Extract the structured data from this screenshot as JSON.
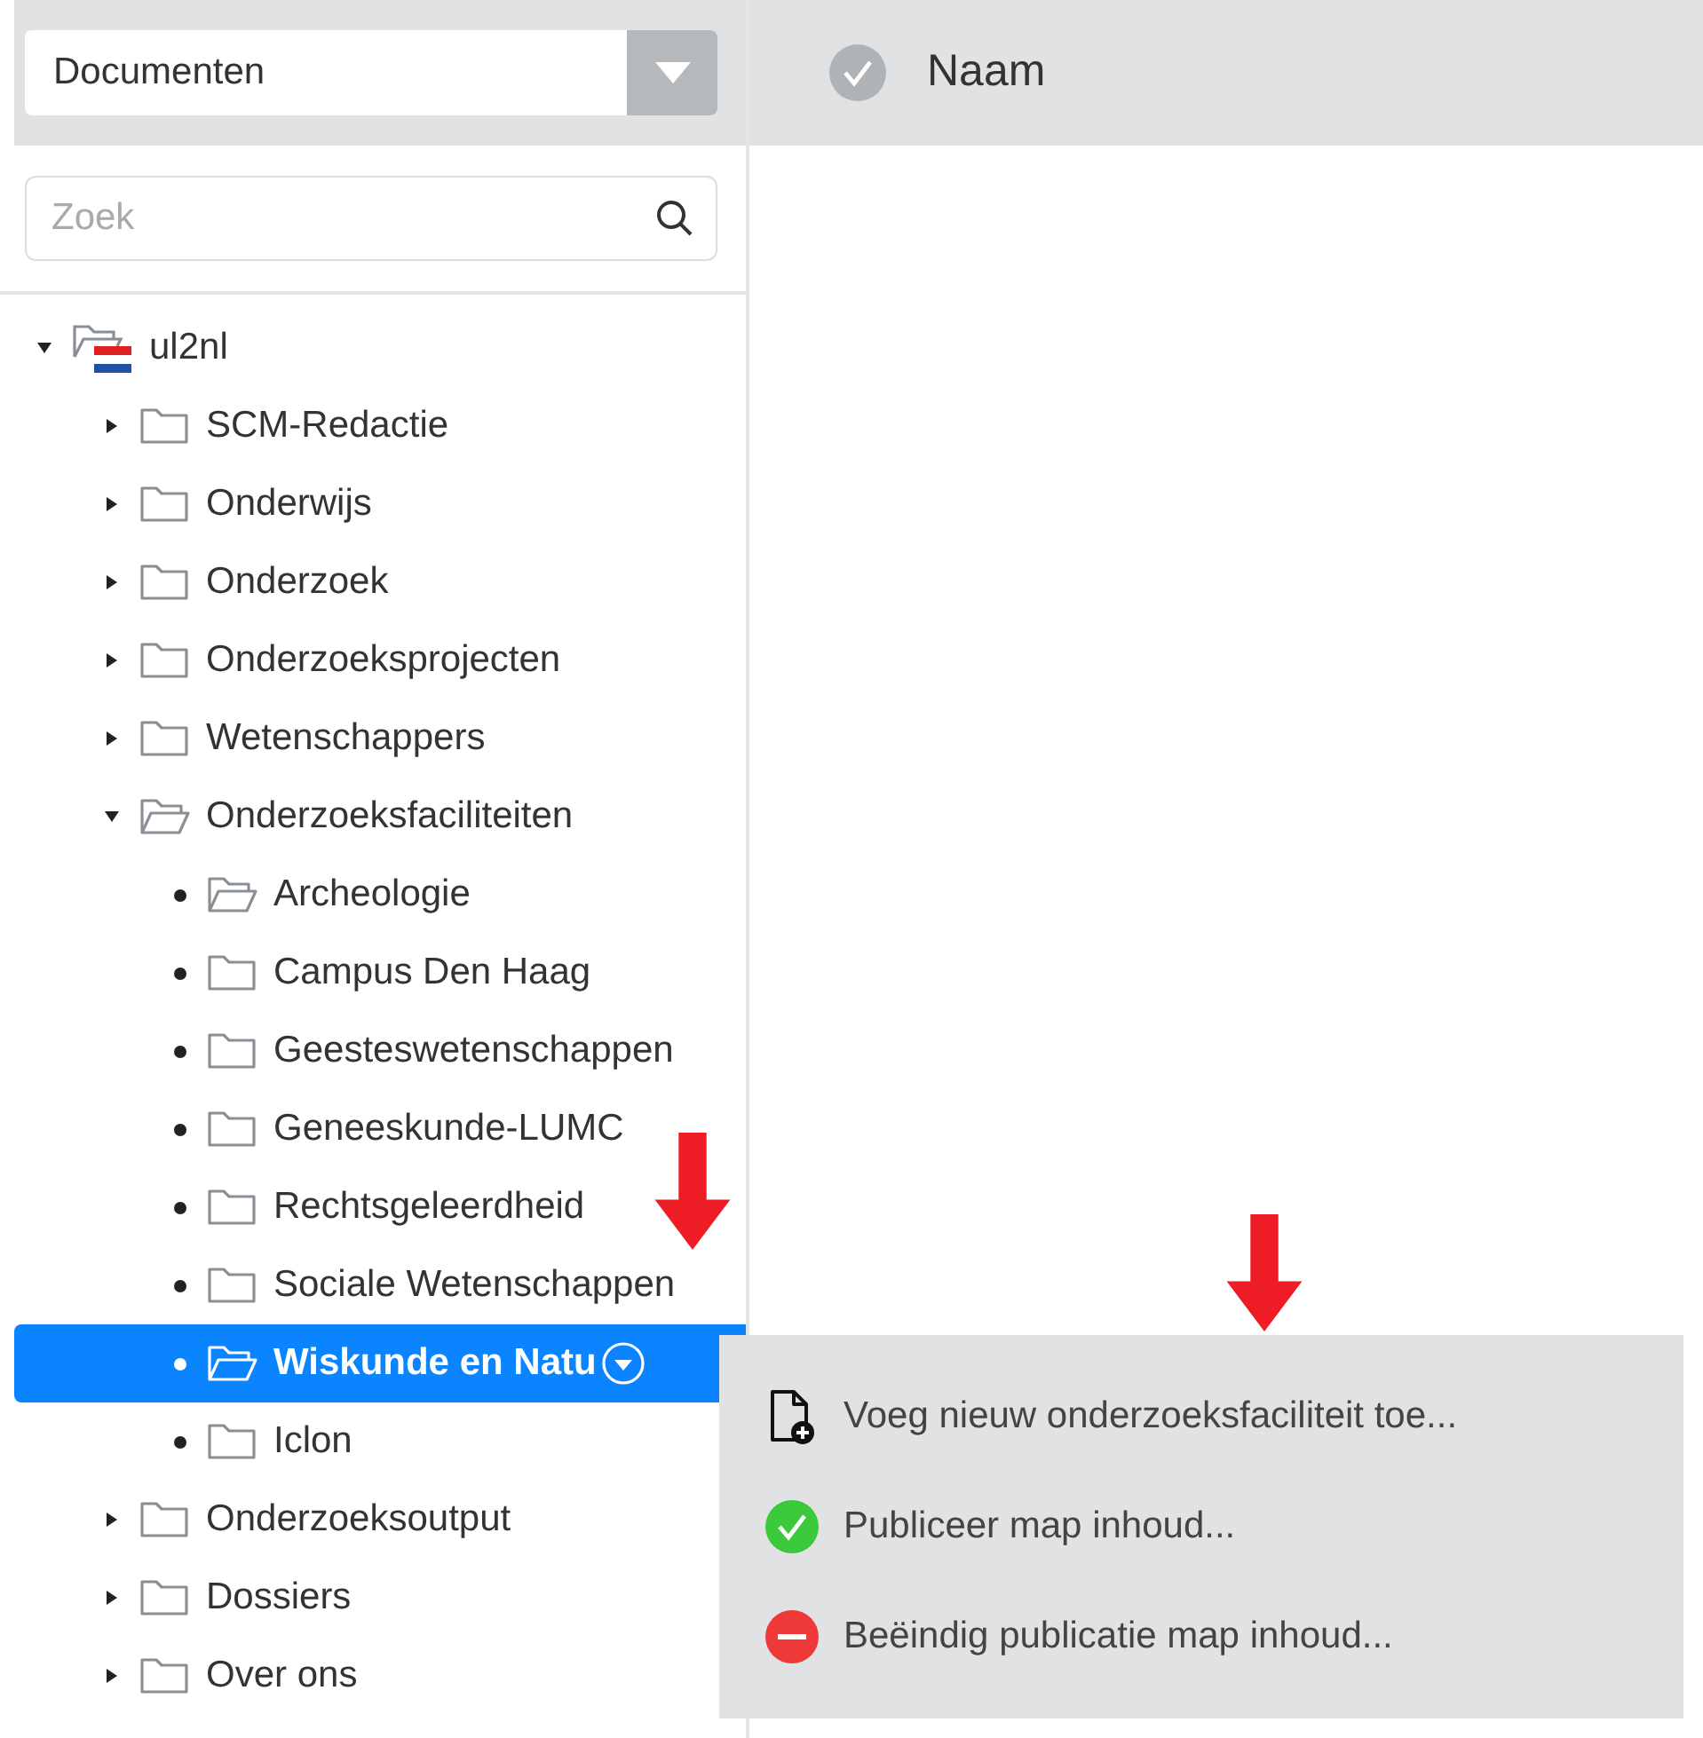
{
  "library_select": {
    "value": "Documenten"
  },
  "search": {
    "placeholder": "Zoek"
  },
  "column_header": {
    "label": "Naam"
  },
  "tree": [
    {
      "label": "ul2nl",
      "kind": "site",
      "expanded": true,
      "folder_open": true,
      "selected": false,
      "children": [
        {
          "label": "SCM-Redactie",
          "kind": "branch",
          "expanded": false,
          "folder_open": false,
          "selected": false
        },
        {
          "label": "Onderwijs",
          "kind": "branch",
          "expanded": false,
          "folder_open": false,
          "selected": false
        },
        {
          "label": "Onderzoek",
          "kind": "branch",
          "expanded": false,
          "folder_open": false,
          "selected": false
        },
        {
          "label": "Onderzoeksprojecten",
          "kind": "branch",
          "expanded": false,
          "folder_open": false,
          "selected": false
        },
        {
          "label": "Wetenschappers",
          "kind": "branch",
          "expanded": false,
          "folder_open": false,
          "selected": false
        },
        {
          "label": "Onderzoeksfaciliteiten",
          "kind": "branch",
          "expanded": true,
          "folder_open": true,
          "selected": false,
          "children": [
            {
              "label": "Archeologie",
              "kind": "leaf",
              "folder_open": true,
              "selected": false
            },
            {
              "label": "Campus Den Haag",
              "kind": "leaf",
              "folder_open": false,
              "selected": false
            },
            {
              "label": "Geesteswetenschappen",
              "kind": "leaf",
              "folder_open": false,
              "selected": false
            },
            {
              "label": "Geneeskunde-LUMC",
              "kind": "leaf",
              "folder_open": false,
              "selected": false
            },
            {
              "label": "Rechtsgeleerdheid",
              "kind": "leaf",
              "folder_open": false,
              "selected": false
            },
            {
              "label": "Sociale Wetenschappen",
              "kind": "leaf",
              "folder_open": false,
              "selected": false
            },
            {
              "label": "Wiskunde en Natu",
              "kind": "leaf",
              "folder_open": true,
              "selected": true
            },
            {
              "label": "Iclon",
              "kind": "leaf",
              "folder_open": false,
              "selected": false
            }
          ]
        },
        {
          "label": "Onderzoeksoutput",
          "kind": "branch",
          "expanded": false,
          "folder_open": false,
          "selected": false
        },
        {
          "label": "Dossiers",
          "kind": "branch",
          "expanded": false,
          "folder_open": false,
          "selected": false
        },
        {
          "label": "Over ons",
          "kind": "branch",
          "expanded": false,
          "folder_open": false,
          "selected": false
        }
      ]
    }
  ],
  "context_menu": [
    {
      "label": "Voeg nieuw onderzoeksfaciliteit toe...",
      "kind": "add"
    },
    {
      "label": "Publiceer map inhoud...",
      "kind": "publish"
    },
    {
      "label": "Beëindig publicatie map inhoud...",
      "kind": "unpublish"
    }
  ]
}
